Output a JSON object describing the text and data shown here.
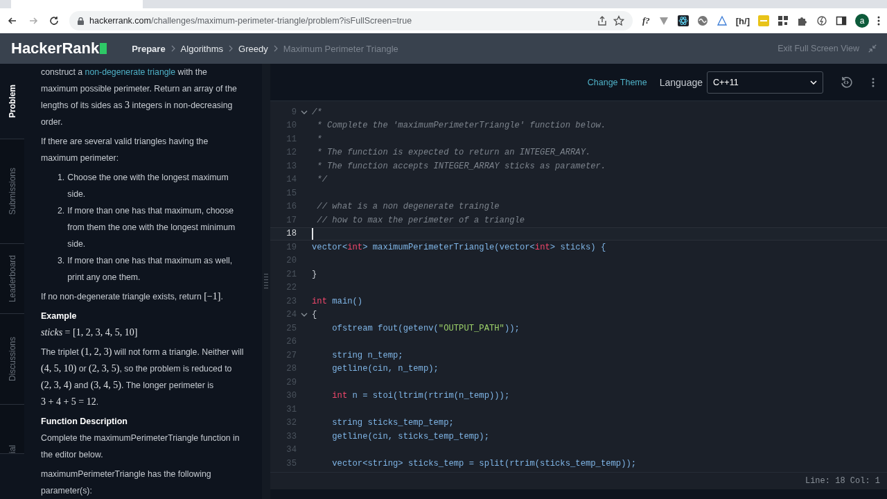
{
  "browser": {
    "url_host": "hackerrank.com",
    "url_path": "/challenges/maximum-perimeter-triangle/problem?isFullScreen=true",
    "ext_f": "f?",
    "ext_h": "[h/]",
    "profile": "a"
  },
  "header": {
    "logo": "HackerRank",
    "breadcrumbs": [
      {
        "label": "Prepare",
        "kind": "root"
      },
      {
        "label": "Algorithms",
        "kind": "link"
      },
      {
        "label": "Greedy",
        "kind": "link"
      },
      {
        "label": "Maximum Perimeter Triangle",
        "kind": "current"
      }
    ],
    "exit": "Exit Full Screen View"
  },
  "side_tabs": [
    {
      "label": "Problem",
      "selected": true
    },
    {
      "label": "Submissions",
      "selected": false
    },
    {
      "label": "Leaderboard",
      "selected": false
    },
    {
      "label": "Discussions",
      "selected": false
    },
    {
      "label": "ial",
      "selected": false
    }
  ],
  "statement": [
    {
      "kind": "para",
      "parts": [
        {
          "kind": "text",
          "text": "construct a "
        },
        {
          "kind": "link",
          "text": "non-degenerate triangle"
        },
        {
          "kind": "text",
          "text": " with the maximum possible perimeter. Return an array of the lengths of its sides as "
        },
        {
          "kind": "math",
          "text": "3"
        },
        {
          "kind": "text",
          "text": " integers in non-decreasing order."
        }
      ]
    },
    {
      "kind": "para",
      "parts": [
        {
          "kind": "text",
          "text": "If there are several valid triangles having the maximum perimeter:"
        }
      ]
    },
    {
      "kind": "list",
      "items": [
        {
          "num": "1.",
          "text": "Choose the one with the longest maximum side."
        },
        {
          "num": "2.",
          "text": "If more than one has that maximum, choose from them the one with the longest minimum side."
        },
        {
          "num": "3.",
          "text": "If more than one has that maximum as well, print any one them."
        }
      ]
    },
    {
      "kind": "para",
      "parts": [
        {
          "kind": "text",
          "text": "If no non-degenerate triangle exists, return "
        },
        {
          "kind": "math",
          "text": "[−1]"
        },
        {
          "kind": "text",
          "text": "."
        }
      ]
    },
    {
      "kind": "heading",
      "text": "Example"
    },
    {
      "kind": "para",
      "parts": [
        {
          "kind": "var",
          "text": "sticks"
        },
        {
          "kind": "math",
          "text": " = [1, 2, 3, 4, 5, 10]"
        }
      ]
    },
    {
      "kind": "para",
      "parts": [
        {
          "kind": "text",
          "text": "The triplet "
        },
        {
          "kind": "math",
          "text": "(1, 2, 3)"
        },
        {
          "kind": "text",
          "text": " will not form a triangle. Neither will "
        },
        {
          "kind": "math",
          "text": "(4, 5, 10)"
        },
        {
          "kind": "text",
          "text": " or "
        },
        {
          "kind": "math",
          "text": "(2, 3, 5)"
        },
        {
          "kind": "text",
          "text": ", so the problem is reduced to "
        },
        {
          "kind": "math",
          "text": "(2, 3, 4)"
        },
        {
          "kind": "text",
          "text": " and "
        },
        {
          "kind": "math",
          "text": "(3, 4, 5)"
        },
        {
          "kind": "text",
          "text": ". The longer perimeter is "
        },
        {
          "kind": "math",
          "text": "3 + 4 + 5 = 12"
        },
        {
          "kind": "text",
          "text": "."
        }
      ]
    },
    {
      "kind": "heading",
      "text": "Function Description"
    },
    {
      "kind": "para",
      "parts": [
        {
          "kind": "text",
          "text": "Complete the maximumPerimeterTriangle function in the editor below."
        }
      ]
    },
    {
      "kind": "para",
      "parts": [
        {
          "kind": "text",
          "text": "maximumPerimeterTriangle has the following parameter(s):"
        }
      ]
    }
  ],
  "editor": {
    "change_theme": "Change Theme",
    "language_label": "Language",
    "language_value": "C++11",
    "status": "Line: 18 Col: 1",
    "lines": [
      {
        "n": "9",
        "fold": true,
        "current": false,
        "tokens": [
          {
            "kind": "comment",
            "text": "/*"
          }
        ]
      },
      {
        "n": "10",
        "fold": false,
        "current": false,
        "tokens": [
          {
            "kind": "comment",
            "text": " * Complete the 'maximumPerimeterTriangle' function below."
          }
        ]
      },
      {
        "n": "11",
        "fold": false,
        "current": false,
        "tokens": [
          {
            "kind": "comment",
            "text": " *"
          }
        ]
      },
      {
        "n": "12",
        "fold": false,
        "current": false,
        "tokens": [
          {
            "kind": "comment",
            "text": " * The function is expected to return an INTEGER_ARRAY."
          }
        ]
      },
      {
        "n": "13",
        "fold": false,
        "current": false,
        "tokens": [
          {
            "kind": "comment",
            "text": " * The function accepts INTEGER_ARRAY sticks as parameter."
          }
        ]
      },
      {
        "n": "14",
        "fold": false,
        "current": false,
        "tokens": [
          {
            "kind": "comment",
            "text": " */"
          }
        ]
      },
      {
        "n": "15",
        "fold": false,
        "current": false
      },
      {
        "n": "16",
        "fold": false,
        "current": false,
        "tokens": [
          {
            "kind": "comment",
            "text": " // what is a non degenerate traingle"
          }
        ]
      },
      {
        "n": "17",
        "fold": false,
        "current": false,
        "tokens": [
          {
            "kind": "comment",
            "text": " // how to max the perimeter of a triangle"
          }
        ]
      },
      {
        "n": "18",
        "fold": false,
        "current": true
      },
      {
        "n": "19",
        "fold": false,
        "current": false,
        "tokens": [
          {
            "kind": "plain",
            "text": "vector<"
          },
          {
            "kind": "keyword",
            "text": "int"
          },
          {
            "kind": "plain",
            "text": "> maximumPerimeterTriangle(vector<"
          },
          {
            "kind": "keyword",
            "text": "int"
          },
          {
            "kind": "plain",
            "text": "> sticks) {"
          }
        ]
      },
      {
        "n": "20",
        "fold": false,
        "current": false
      },
      {
        "n": "21",
        "fold": false,
        "current": false,
        "tokens": [
          {
            "kind": "punct",
            "text": "}"
          }
        ]
      },
      {
        "n": "22",
        "fold": false,
        "current": false
      },
      {
        "n": "23",
        "fold": false,
        "current": false,
        "tokens": [
          {
            "kind": "keyword",
            "text": "int"
          },
          {
            "kind": "plain",
            "text": " main()"
          }
        ]
      },
      {
        "n": "24",
        "fold": true,
        "current": false,
        "tokens": [
          {
            "kind": "punct",
            "text": "{"
          }
        ]
      },
      {
        "n": "25",
        "fold": false,
        "current": false,
        "tokens": [
          {
            "kind": "plain",
            "text": "    ofstream fout(getenv("
          },
          {
            "kind": "string",
            "text": "\"OUTPUT_PATH\""
          },
          {
            "kind": "plain",
            "text": "));"
          }
        ]
      },
      {
        "n": "26",
        "fold": false,
        "current": false
      },
      {
        "n": "27",
        "fold": false,
        "current": false,
        "tokens": [
          {
            "kind": "plain",
            "text": "    string n_temp;"
          }
        ]
      },
      {
        "n": "28",
        "fold": false,
        "current": false,
        "tokens": [
          {
            "kind": "plain",
            "text": "    getline(cin, n_temp);"
          }
        ]
      },
      {
        "n": "29",
        "fold": false,
        "current": false
      },
      {
        "n": "30",
        "fold": false,
        "current": false,
        "tokens": [
          {
            "kind": "keyword",
            "text": "    int"
          },
          {
            "kind": "plain",
            "text": " n = stoi(ltrim(rtrim(n_temp)));"
          }
        ]
      },
      {
        "n": "31",
        "fold": false,
        "current": false
      },
      {
        "n": "32",
        "fold": false,
        "current": false,
        "tokens": [
          {
            "kind": "plain",
            "text": "    string sticks_temp_temp;"
          }
        ]
      },
      {
        "n": "33",
        "fold": false,
        "current": false,
        "tokens": [
          {
            "kind": "plain",
            "text": "    getline(cin, sticks_temp_temp);"
          }
        ]
      },
      {
        "n": "34",
        "fold": false,
        "current": false
      },
      {
        "n": "35",
        "fold": false,
        "current": false,
        "tokens": [
          {
            "kind": "plain",
            "text": "    vector<string> sticks_temp = split(rtrim(sticks_temp_temp));"
          }
        ]
      }
    ]
  }
}
